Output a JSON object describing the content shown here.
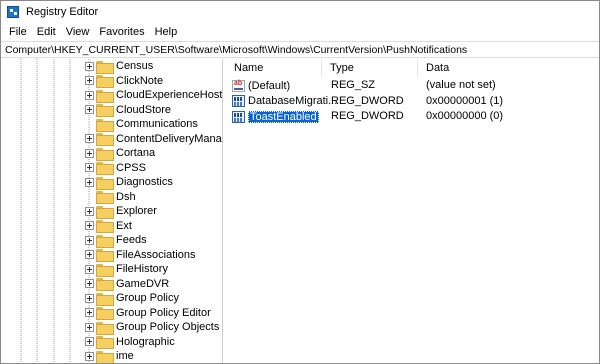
{
  "window": {
    "title": "Registry Editor",
    "icon": "registry-icon"
  },
  "menu": [
    "File",
    "Edit",
    "View",
    "Favorites",
    "Help"
  ],
  "address": "Computer\\HKEY_CURRENT_USER\\Software\\Microsoft\\Windows\\CurrentVersion\\PushNotifications",
  "tree": [
    {
      "label": "Census",
      "expandable": true
    },
    {
      "label": "ClickNote",
      "expandable": true
    },
    {
      "label": "CloudExperienceHost",
      "expandable": true
    },
    {
      "label": "CloudStore",
      "expandable": true
    },
    {
      "label": "Communications",
      "expandable": false
    },
    {
      "label": "ContentDeliveryManag",
      "expandable": true
    },
    {
      "label": "Cortana",
      "expandable": true
    },
    {
      "label": "CPSS",
      "expandable": true
    },
    {
      "label": "Diagnostics",
      "expandable": true
    },
    {
      "label": "Dsh",
      "expandable": false
    },
    {
      "label": "Explorer",
      "expandable": true
    },
    {
      "label": "Ext",
      "expandable": true
    },
    {
      "label": "Feeds",
      "expandable": true
    },
    {
      "label": "FileAssociations",
      "expandable": true
    },
    {
      "label": "FileHistory",
      "expandable": true
    },
    {
      "label": "GameDVR",
      "expandable": true
    },
    {
      "label": "Group Policy",
      "expandable": true
    },
    {
      "label": "Group Policy Editor",
      "expandable": true
    },
    {
      "label": "Group Policy Objects",
      "expandable": true
    },
    {
      "label": "Holographic",
      "expandable": true
    },
    {
      "label": "ime",
      "expandable": true
    }
  ],
  "columns": {
    "name": "Name",
    "type": "Type",
    "data": "Data"
  },
  "values": [
    {
      "icon": "string-value-icon",
      "name": "(Default)",
      "type": "REG_SZ",
      "data": "(value not set)",
      "selected": false
    },
    {
      "icon": "dword-value-icon",
      "name": "DatabaseMigrati...",
      "type": "REG_DWORD",
      "data": "0x00000001 (1)",
      "selected": false
    },
    {
      "icon": "dword-value-icon",
      "name": "ToastEnabled",
      "type": "REG_DWORD",
      "data": "0x00000000 (0)",
      "selected": true
    }
  ],
  "colors": {
    "selection": "#0a64d6",
    "folder": "#f6cf61"
  }
}
